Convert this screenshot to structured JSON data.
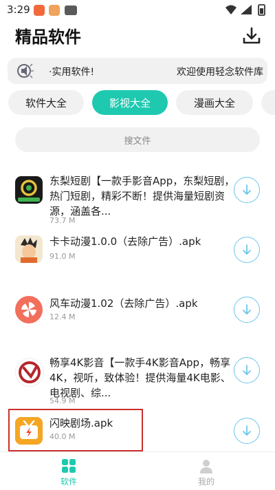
{
  "status_bar": {
    "time": "3:29"
  },
  "header": {
    "title": "精品软件"
  },
  "notice": {
    "text_left": "·实用软件!",
    "text_right": "欢迎使用轻念软件库"
  },
  "tabs": [
    {
      "label": "软件大全",
      "active": false
    },
    {
      "label": "影视大全",
      "active": true
    },
    {
      "label": "漫画大全",
      "active": false
    }
  ],
  "search": {
    "placeholder": "搜文件"
  },
  "apps": [
    {
      "name": "东梨短剧【一款手影音App，东梨短剧，热门短剧，精彩不断！提供海量短剧资源，涵盖各...",
      "size": "73.7 M",
      "icon": "dongli-duanju-icon"
    },
    {
      "name": "卡卡动漫1.0.0（去除广告）.apk",
      "size": "91.0 M",
      "icon": "kaka-dongman-icon"
    },
    {
      "name": "风车动漫1.02（去除广告）.apk",
      "size": "12.4 M",
      "icon": "fengche-dongman-icon"
    },
    {
      "name": "畅享4K影音【一款手4K影音App，畅享4K，视听，致体验！提供海量4K电影、电视剧、综...",
      "size": "54.9 M",
      "icon": "changxiang-4k-icon"
    },
    {
      "name": "闪映剧场.apk",
      "size": "40.0 M",
      "icon": "shanying-juchang-icon"
    }
  ],
  "bottom_nav": [
    {
      "label": "软件",
      "active": true
    },
    {
      "label": "我的",
      "active": false
    }
  ],
  "colors": {
    "accent": "#1ec9b0",
    "download_ring": "#6cc6e8",
    "highlight": "#c9302c"
  }
}
